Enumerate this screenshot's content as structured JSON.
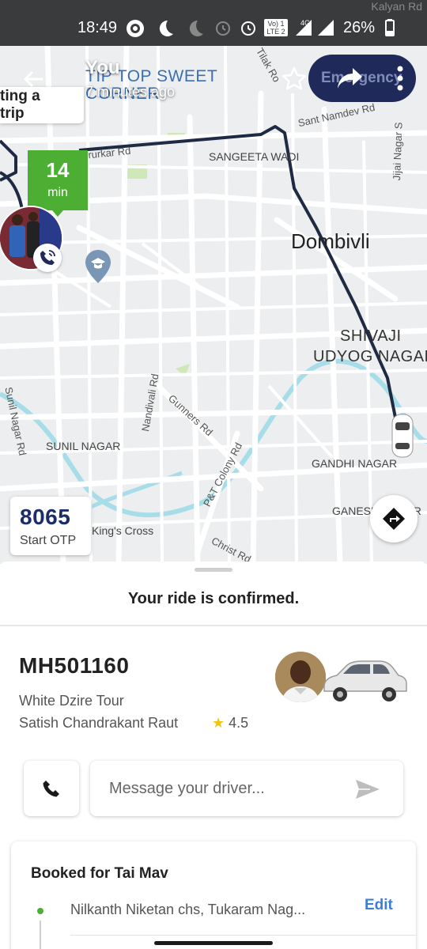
{
  "status_bar": {
    "time": "18:49",
    "battery": "26%",
    "network": "4G",
    "lte_badge": "LTE 2",
    "volte": "Vo) 1",
    "corner_place": "Kalyan Rd"
  },
  "header": {
    "title": "You",
    "subtitle": "7 minutes ago",
    "poi_text": "TIP TOP SWEET CORNER",
    "emergency_label": "Emergency"
  },
  "map": {
    "trip_chip": "ting a trip",
    "eta_value": "14",
    "eta_unit": "min",
    "otp_code": "8065",
    "otp_label": "Start OTP",
    "labels": {
      "sant_namdev": "Sant Namdev Rd",
      "jijai_nagar": "Jijai Nagar S",
      "tilak": "Tilak Ro",
      "rkurkar": "erurkar Rd",
      "sangeeta_wadi": "SANGEETA WADI",
      "dombivli": "Dombivli",
      "shivaji_1": "SHIVAJI",
      "shivaji_2": "UDYOG NAGAR",
      "nandivali": "Nandivali Rd",
      "gunners": "Gunners Rd",
      "sunil_nagar_rd": "Sunil Nagar Rd",
      "pt_colony": "P&T Colony Rd",
      "sunil_nagar": "SUNIL NAGAR",
      "gandhi_nagar": "GANDHI NAGAR",
      "ganesh_nagar": "GANESH NAGAR",
      "kings_cross": "King's Cross",
      "christ": "Christ Rd"
    }
  },
  "ride": {
    "confirmed_text": "Your ride is confirmed.",
    "plate": "MH501160",
    "car_model": "White Dzire Tour",
    "driver_name": "Satish Chandrakant Raut",
    "rating_star": "★",
    "rating": "4.5",
    "message_placeholder": "Message your driver..."
  },
  "booking": {
    "title": "Booked for Tai Mav",
    "pickup": "Nilkanth Niketan chs, Tukaram Nag...",
    "edit_label": "Edit"
  },
  "colors": {
    "eta_green": "#4caf34",
    "emergency_navy": "#1f2a5a",
    "otp_blue": "#1b2e6a",
    "link_blue": "#3b7fd4",
    "route": "#1f2a44",
    "water": "#a6dde8"
  },
  "icons": [
    "back-arrow-icon",
    "star-outline-icon",
    "share-icon",
    "more-vert-icon",
    "phone-icon",
    "send-icon",
    "directions-icon",
    "school-pin-icon",
    "car-marker-icon"
  ]
}
